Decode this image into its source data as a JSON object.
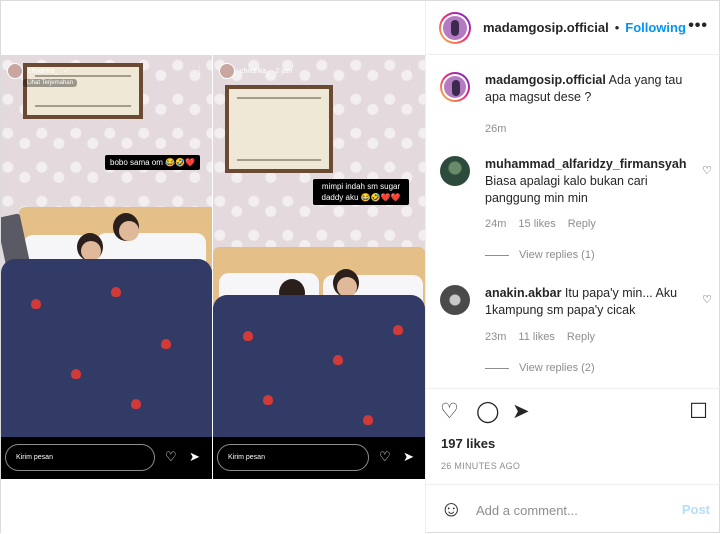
{
  "story_left": {
    "username": "chndrika_",
    "verified_mark": "✓",
    "subtitle": "Lihat Terjemahan",
    "sticker": "bobo sama om 😂🤣❤️",
    "reply_placeholder": "Kirim pesan",
    "heart_icon": "heart-icon",
    "send_icon": "send-icon"
  },
  "story_right": {
    "username": "chndrika_",
    "time": "2 jam",
    "sticker": "mimpi indah sm sugar daddy aku 😂🤣❤️❤️",
    "reply_placeholder": "Kirim pesan"
  },
  "header": {
    "username": "madamgosip.official",
    "separator": "•",
    "follow_status": "Following",
    "more": "•••"
  },
  "caption": {
    "username": "madamgosip.official",
    "text": "Ada yang tau apa magsut dese ?",
    "time": "26m"
  },
  "comments": [
    {
      "username": "muhammad_alfaridzy_firmansyah",
      "text": "Biasa apalagi kalo bukan cari panggung min min",
      "time": "24m",
      "likes": "15 likes",
      "reply": "Reply",
      "view_replies": "View replies (1)"
    },
    {
      "username": "anakin.akbar",
      "text": "Itu papa'y min... Aku 1kampung sm papa'y cicak",
      "time": "23m",
      "likes": "11 likes",
      "reply": "Reply",
      "view_replies": "View replies (2)"
    }
  ],
  "post": {
    "likes": "197 likes",
    "timestamp": "26 MINUTES AGO"
  },
  "add_comment": {
    "placeholder": "Add a comment...",
    "post_label": "Post"
  },
  "colors": {
    "link_blue": "#0095f6",
    "muted": "#8e8e8e",
    "post_disabled": "#b2dffc"
  }
}
